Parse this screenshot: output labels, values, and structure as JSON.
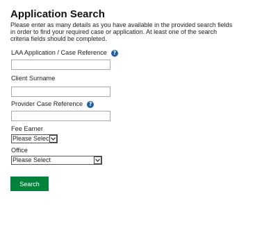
{
  "page": {
    "title": "Application Search",
    "intro": "Please enter as many details as you have available in the provided search fields in order to find your required case or application. At least one of the search criteria fields should be completed."
  },
  "fields": {
    "laa_reference": {
      "label": "LAA Application / Case Reference",
      "value": "",
      "help_icon": "help-question-icon"
    },
    "client_surname": {
      "label": "Client Surname",
      "value": ""
    },
    "provider_case_reference": {
      "label": "Provider Case Reference",
      "value": "",
      "help_icon": "help-question-icon"
    },
    "fee_earner": {
      "label": "Fee Earner",
      "selected": "Please Select"
    },
    "office": {
      "label": "Office",
      "selected": "Please Select"
    }
  },
  "actions": {
    "search_label": "Search"
  },
  "colors": {
    "button": "#00823b",
    "help_icon": "#1f5fa6"
  }
}
